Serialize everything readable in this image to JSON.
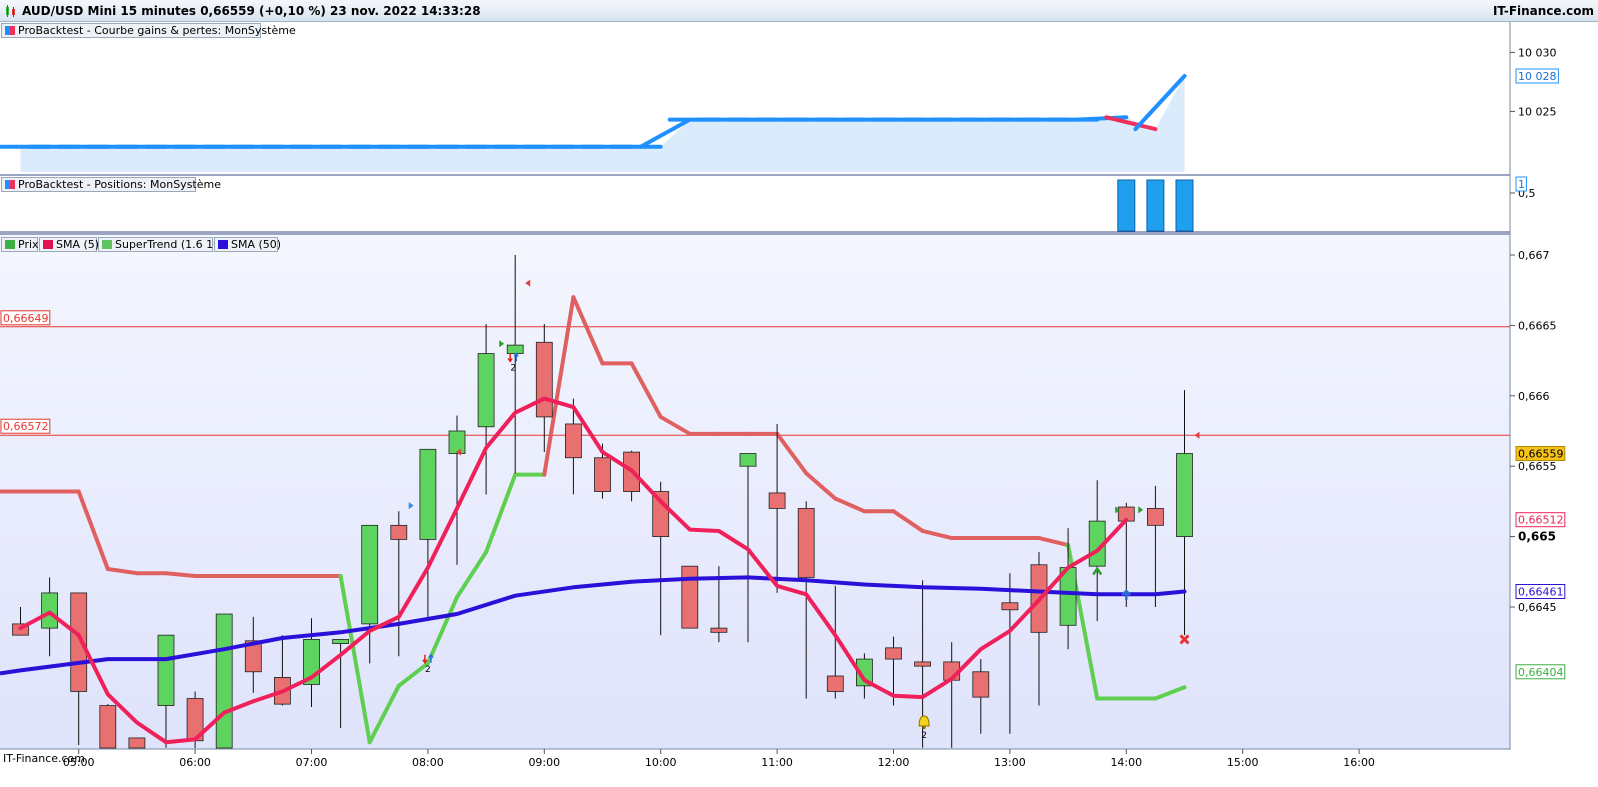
{
  "header": {
    "title": "AUD/USD Mini 15 minutes 0,66559 (+0,10 %) 23 nov. 2022 14:33:28",
    "brand": "IT-Finance.com"
  },
  "footer": {
    "brand": "IT-Finance.com"
  },
  "panels": {
    "equity": {
      "legend": "ProBacktest - Courbe gains & pertes: MonSystème",
      "ticks": [
        "10 030",
        "10 025"
      ],
      "last_label": "10 028"
    },
    "positions": {
      "legend": "ProBacktest - Positions: MonSystème",
      "ticks": [
        "0,5"
      ],
      "last_label": "1"
    },
    "price": {
      "legends": [
        {
          "label": "Prix",
          "color": "#3cb043"
        },
        {
          "label": "SMA (5)",
          "color": "#e0114f"
        },
        {
          "label": "SuperTrend (1.6 10)",
          "color": "#5fc45f"
        },
        {
          "label": "SMA (50)",
          "color": "#2a10d8"
        }
      ],
      "ticks": [
        "0,667",
        "0,6665",
        "0,666",
        "0,6655",
        "0,665",
        "0,6645"
      ],
      "current_price_label": "0,66559",
      "sma5_label": "0,66512",
      "sma50_label": "0,66461",
      "supertrend_label": "0,66404",
      "hlines": [
        {
          "label": "0,66649",
          "value": 0.66649
        },
        {
          "label": "0,66572",
          "value": 0.66572
        }
      ],
      "annotation_counts": [
        "2",
        "2",
        "2"
      ]
    }
  },
  "x_axis": {
    "ticks": [
      "05:00",
      "06:00",
      "07:00",
      "08:00",
      "09:00",
      "10:00",
      "11:00",
      "12:00",
      "13:00",
      "14:00",
      "15:00",
      "16:00"
    ]
  },
  "colors": {
    "up": "#5fd35f",
    "down": "#e87070",
    "equity": "#1e90ff",
    "equity_loss": "#f0305a",
    "sma5": "#f0205a",
    "sma50": "#2a10d8",
    "st_up": "#5fcf50",
    "st_down": "#e06060",
    "hline": "#e8362e"
  },
  "chart_data": [
    {
      "type": "line",
      "title": "ProBacktest - Courbe gains & pertes: MonSystème",
      "x": [
        "04:30",
        "04:45",
        "05:00",
        "05:15",
        "05:30",
        "05:45",
        "06:00",
        "06:15",
        "06:30",
        "06:45",
        "07:00",
        "07:15",
        "07:30",
        "07:45",
        "08:00",
        "08:15",
        "08:30",
        "08:45",
        "09:00",
        "09:15",
        "09:30",
        "09:45",
        "10:00",
        "10:15",
        "10:30",
        "10:45",
        "11:00",
        "11:15",
        "11:30",
        "11:45",
        "12:00",
        "12:15",
        "12:30",
        "12:45",
        "13:00",
        "13:15",
        "13:30",
        "13:45",
        "14:00",
        "14:15",
        "14:30"
      ],
      "values": [
        10022.0,
        10022.0,
        10022.0,
        10022.0,
        10022.0,
        10022.0,
        10022.0,
        10022.0,
        10022.0,
        10022.0,
        10022.0,
        10022.0,
        10022.0,
        10022.0,
        10022.0,
        10022.0,
        10022.0,
        10022.0,
        10022.0,
        10022.0,
        10022.0,
        10022.0,
        10022.0,
        10024.3,
        10024.3,
        10024.3,
        10024.3,
        10024.3,
        10024.3,
        10024.3,
        10024.3,
        10024.3,
        10024.3,
        10024.3,
        10024.3,
        10024.3,
        10024.3,
        10024.3,
        10024.5,
        10023.5,
        10028.0
      ],
      "ylim": [
        10020.6,
        10031.0
      ]
    },
    {
      "type": "bar",
      "title": "ProBacktest - Positions: MonSystème",
      "x": [
        "14:00",
        "14:15",
        "14:30"
      ],
      "values": [
        1,
        1,
        1
      ],
      "ylim": [
        0,
        1
      ]
    },
    {
      "type": "candlestick",
      "title": "Prix",
      "x": [
        "04:30",
        "04:45",
        "05:00",
        "05:15",
        "05:30",
        "05:45",
        "06:00",
        "06:15",
        "06:30",
        "06:45",
        "07:00",
        "07:15",
        "07:30",
        "07:45",
        "08:00",
        "08:15",
        "08:30",
        "08:45",
        "09:00",
        "09:15",
        "09:30",
        "09:45",
        "10:00",
        "10:15",
        "10:30",
        "10:45",
        "11:00",
        "11:15",
        "11:30",
        "11:45",
        "12:00",
        "12:15",
        "12:30",
        "12:45",
        "13:00",
        "13:15",
        "13:30",
        "13:45",
        "14:00",
        "14:15",
        "14:30"
      ],
      "open": [
        0.66438,
        0.66435,
        0.6646,
        0.6638,
        0.66357,
        0.6638,
        0.66385,
        0.6634,
        0.66426,
        0.664,
        0.66395,
        0.66424,
        0.66438,
        0.66508,
        0.66498,
        0.66559,
        0.66578,
        0.6663,
        0.66638,
        0.6658,
        0.66556,
        0.6656,
        0.66532,
        0.66479,
        0.66435,
        0.6655,
        0.66531,
        0.6652,
        0.66401,
        0.66394,
        0.66421,
        0.66411,
        0.66411,
        0.66404,
        0.66453,
        0.6648,
        0.66437,
        0.66479,
        0.66521,
        0.6652,
        0.665
      ],
      "high": [
        0.6645,
        0.66471,
        0.6646,
        0.66381,
        0.66357,
        0.66396,
        0.6639,
        0.66443,
        0.66443,
        0.6643,
        0.66442,
        0.66427,
        0.66508,
        0.66518,
        0.6656,
        0.66586,
        0.66651,
        0.667,
        0.66651,
        0.66598,
        0.66566,
        0.66561,
        0.66539,
        0.66479,
        0.66479,
        0.6655,
        0.6658,
        0.66525,
        0.66465,
        0.66417,
        0.66429,
        0.66469,
        0.66425,
        0.66413,
        0.66474,
        0.66489,
        0.66506,
        0.6654,
        0.66524,
        0.66536,
        0.66604
      ],
      "low": [
        0.6643,
        0.66415,
        0.66352,
        0.6633,
        0.6633,
        0.6635,
        0.6634,
        0.66327,
        0.66389,
        0.6638,
        0.66379,
        0.66364,
        0.6641,
        0.66415,
        0.6644,
        0.6648,
        0.6653,
        0.66545,
        0.6656,
        0.6653,
        0.66527,
        0.66525,
        0.6643,
        0.6644,
        0.66425,
        0.66425,
        0.6646,
        0.66385,
        0.66385,
        0.66385,
        0.6638,
        0.6635,
        0.6635,
        0.6636,
        0.6636,
        0.6638,
        0.6642,
        0.6644,
        0.6645,
        0.6645,
        0.6643
      ],
      "close": [
        0.6643,
        0.6646,
        0.6639,
        0.66335,
        0.6633,
        0.6643,
        0.66355,
        0.66445,
        0.66404,
        0.66381,
        0.66427,
        0.66427,
        0.66508,
        0.66498,
        0.66562,
        0.66575,
        0.6663,
        0.66636,
        0.66585,
        0.66556,
        0.66532,
        0.66532,
        0.665,
        0.66435,
        0.66432,
        0.66559,
        0.6652,
        0.66471,
        0.6639,
        0.66413,
        0.66413,
        0.66408,
        0.66398,
        0.66386,
        0.66448,
        0.66432,
        0.66478,
        0.66511,
        0.66511,
        0.66508,
        0.66559
      ]
    },
    {
      "type": "line",
      "title": "SMA (5)",
      "x": [
        "04:30",
        "04:45",
        "05:00",
        "05:15",
        "05:30",
        "05:45",
        "06:00",
        "06:15",
        "06:30",
        "06:45",
        "07:00",
        "07:15",
        "07:30",
        "07:45",
        "08:00",
        "08:15",
        "08:30",
        "08:45",
        "09:00",
        "09:15",
        "09:30",
        "09:45",
        "10:00",
        "10:15",
        "10:30",
        "10:45",
        "11:00",
        "11:15",
        "11:30",
        "11:45",
        "12:00",
        "12:15",
        "12:30",
        "12:45",
        "13:00",
        "13:15",
        "13:30",
        "13:45",
        "14:00",
        "14:15",
        "14:30"
      ],
      "values": [
        0.66435,
        0.66446,
        0.6643,
        0.66388,
        0.66368,
        0.66354,
        0.66356,
        0.66375,
        0.66383,
        0.6639,
        0.664,
        0.66416,
        0.66433,
        0.66443,
        0.66478,
        0.6652,
        0.66563,
        0.66588,
        0.66598,
        0.66592,
        0.6656,
        0.66547,
        0.66525,
        0.66505,
        0.66504,
        0.66491,
        0.66465,
        0.66459,
        0.6643,
        0.66398,
        0.66387,
        0.66386,
        0.66399,
        0.6642,
        0.66433,
        0.66455,
        0.66478,
        0.6649,
        0.66512
      ]
    },
    {
      "type": "line",
      "title": "SMA (50)",
      "x": [
        "04:30",
        "05:15",
        "05:45",
        "06:15",
        "06:45",
        "07:15",
        "07:45",
        "08:15",
        "08:45",
        "09:15",
        "09:45",
        "10:15",
        "10:45",
        "11:15",
        "11:45",
        "12:15",
        "12:45",
        "13:15",
        "13:45",
        "14:15",
        "14:30"
      ],
      "values": [
        0.66405,
        0.66413,
        0.66413,
        0.6642,
        0.66428,
        0.66432,
        0.66438,
        0.66445,
        0.66458,
        0.66464,
        0.66468,
        0.6647,
        0.66471,
        0.66469,
        0.66466,
        0.66464,
        0.66463,
        0.66461,
        0.66459,
        0.66459,
        0.66461
      ]
    },
    {
      "type": "line",
      "title": "SuperTrend (1.6 10)",
      "x": [
        "04:30",
        "04:45",
        "05:00",
        "05:15",
        "05:30",
        "05:45",
        "06:00",
        "06:15",
        "06:30",
        "06:45",
        "07:00",
        "07:15",
        "07:30",
        "07:45",
        "08:00",
        "08:15",
        "08:30",
        "08:45",
        "09:00",
        "09:15",
        "09:30",
        "09:45",
        "10:00",
        "10:15",
        "10:30",
        "10:45",
        "11:00",
        "11:15",
        "11:30",
        "11:45",
        "12:00",
        "12:15",
        "12:30",
        "12:45",
        "13:00",
        "13:15",
        "13:30",
        "13:45",
        "14:00",
        "14:15",
        "14:30"
      ],
      "values": [
        0.66532,
        0.66532,
        0.66532,
        0.66477,
        0.66474,
        0.66474,
        0.66472,
        0.66472,
        0.66472,
        0.66472,
        0.66472,
        0.66472,
        0.66354,
        0.66394,
        0.6641,
        0.66457,
        0.66489,
        0.66544,
        0.66544,
        0.6667,
        0.66623,
        0.66623,
        0.66585,
        0.66573,
        0.66573,
        0.66573,
        0.66573,
        0.66545,
        0.66527,
        0.66518,
        0.66518,
        0.66504,
        0.66499,
        0.66499,
        0.66499,
        0.66499,
        0.66494,
        0.66385,
        0.66385,
        0.66385,
        0.66393
      ],
      "direction": [
        "down",
        "down",
        "down",
        "down",
        "down",
        "down",
        "down",
        "down",
        "down",
        "down",
        "down",
        "down",
        "up",
        "up",
        "up",
        "up",
        "up",
        "up",
        "up",
        "down",
        "down",
        "down",
        "down",
        "down",
        "down",
        "down",
        "down",
        "down",
        "down",
        "down",
        "down",
        "down",
        "down",
        "down",
        "down",
        "down",
        "down",
        "up",
        "up",
        "up",
        "up"
      ],
      "ylim": [
        0.66326,
        0.66702
      ]
    }
  ]
}
